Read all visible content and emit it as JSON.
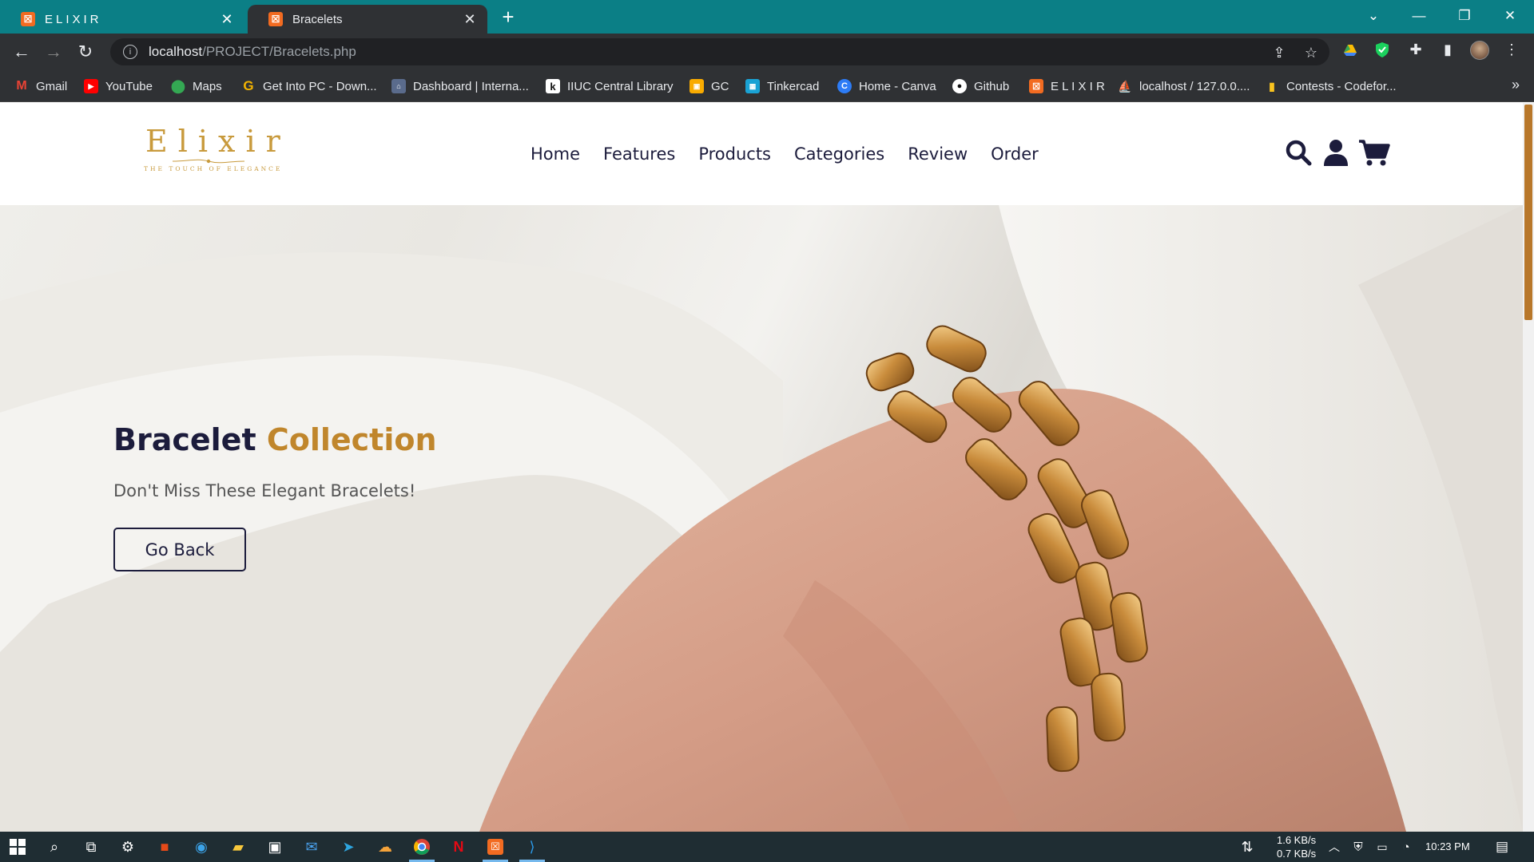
{
  "browser": {
    "tabs": [
      {
        "title": "ELIXIR",
        "favicon": "xampp-icon",
        "state": "inactive"
      },
      {
        "title": "Bracelets",
        "favicon": "xampp-icon",
        "state": "active"
      }
    ],
    "url_host": "localhost",
    "url_path": "/PROJECT/Bracelets.php",
    "bookmarks": [
      {
        "label": "Gmail",
        "icon": "gmail-icon",
        "color": "#ea4335"
      },
      {
        "label": "YouTube",
        "icon": "youtube-icon",
        "color": "#ff0000"
      },
      {
        "label": "Maps",
        "icon": "maps-icon",
        "color": "#34a853"
      },
      {
        "label": "Get Into PC - Down...",
        "icon": "getintopc-icon",
        "color": "#f4b400"
      },
      {
        "label": "Dashboard | Interna...",
        "icon": "university-icon",
        "color": "#5a6b8c"
      },
      {
        "label": "IIUC Central Library",
        "icon": "library-icon",
        "color": "#2e7d32"
      },
      {
        "label": "GC",
        "icon": "classroom-icon",
        "color": "#f9ab00"
      },
      {
        "label": "Tinkercad",
        "icon": "tinkercad-icon",
        "color": "#1aa2d4"
      },
      {
        "label": "Home - Canva",
        "icon": "canva-icon",
        "color": "#2d7cf6"
      },
      {
        "label": "Github",
        "icon": "github-icon",
        "color": "#ffffff"
      },
      {
        "label": "E L I X I R",
        "icon": "xampp-icon",
        "color": "#f26b21"
      },
      {
        "label": "localhost / 127.0.0....",
        "icon": "phpmyadmin-icon",
        "color": "#f29111"
      },
      {
        "label": "Contests - Codefor...",
        "icon": "codeforces-icon",
        "color": "#1f8acb"
      }
    ]
  },
  "site": {
    "logo_text": "Elixir",
    "logo_tagline": "THE TOUCH OF ELEGANCE",
    "nav": [
      "Home",
      "Features",
      "Products",
      "Categories",
      "Review",
      "Order"
    ],
    "icons": [
      "search-icon",
      "user-icon",
      "cart-icon"
    ],
    "brand_color": "#c0862c",
    "dark_color": "#1c1c3c"
  },
  "hero": {
    "title_main": "Bracelet",
    "title_accent": "Collection",
    "subtitle": "Don't Miss These Elegant Bracelets!",
    "button_label": "Go Back"
  },
  "taskbar": {
    "download_speed": "1.6 KB/s",
    "upload_speed": "0.7 KB/s",
    "time": "10:23 PM"
  }
}
